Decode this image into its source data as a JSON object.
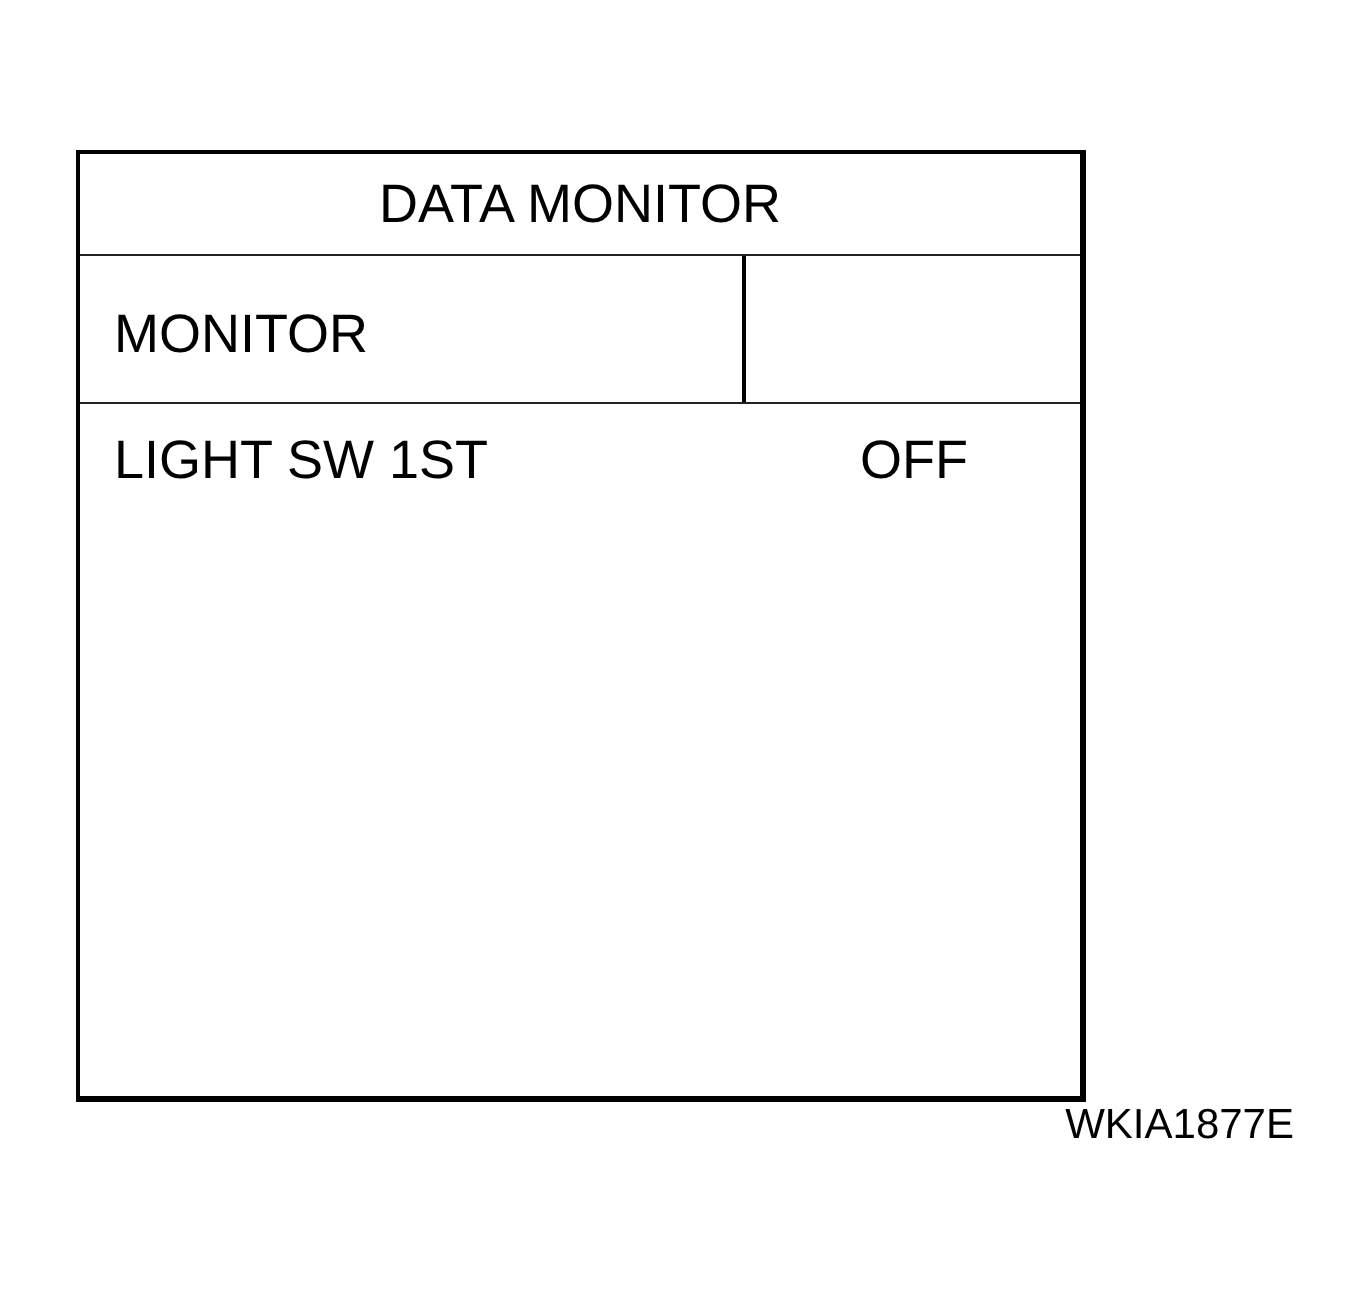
{
  "title": "DATA MONITOR",
  "header": {
    "column_1": "MONITOR"
  },
  "rows": [
    {
      "item": "LIGHT SW 1ST",
      "value": "OFF"
    }
  ],
  "figure_id": "WKIA1877E"
}
